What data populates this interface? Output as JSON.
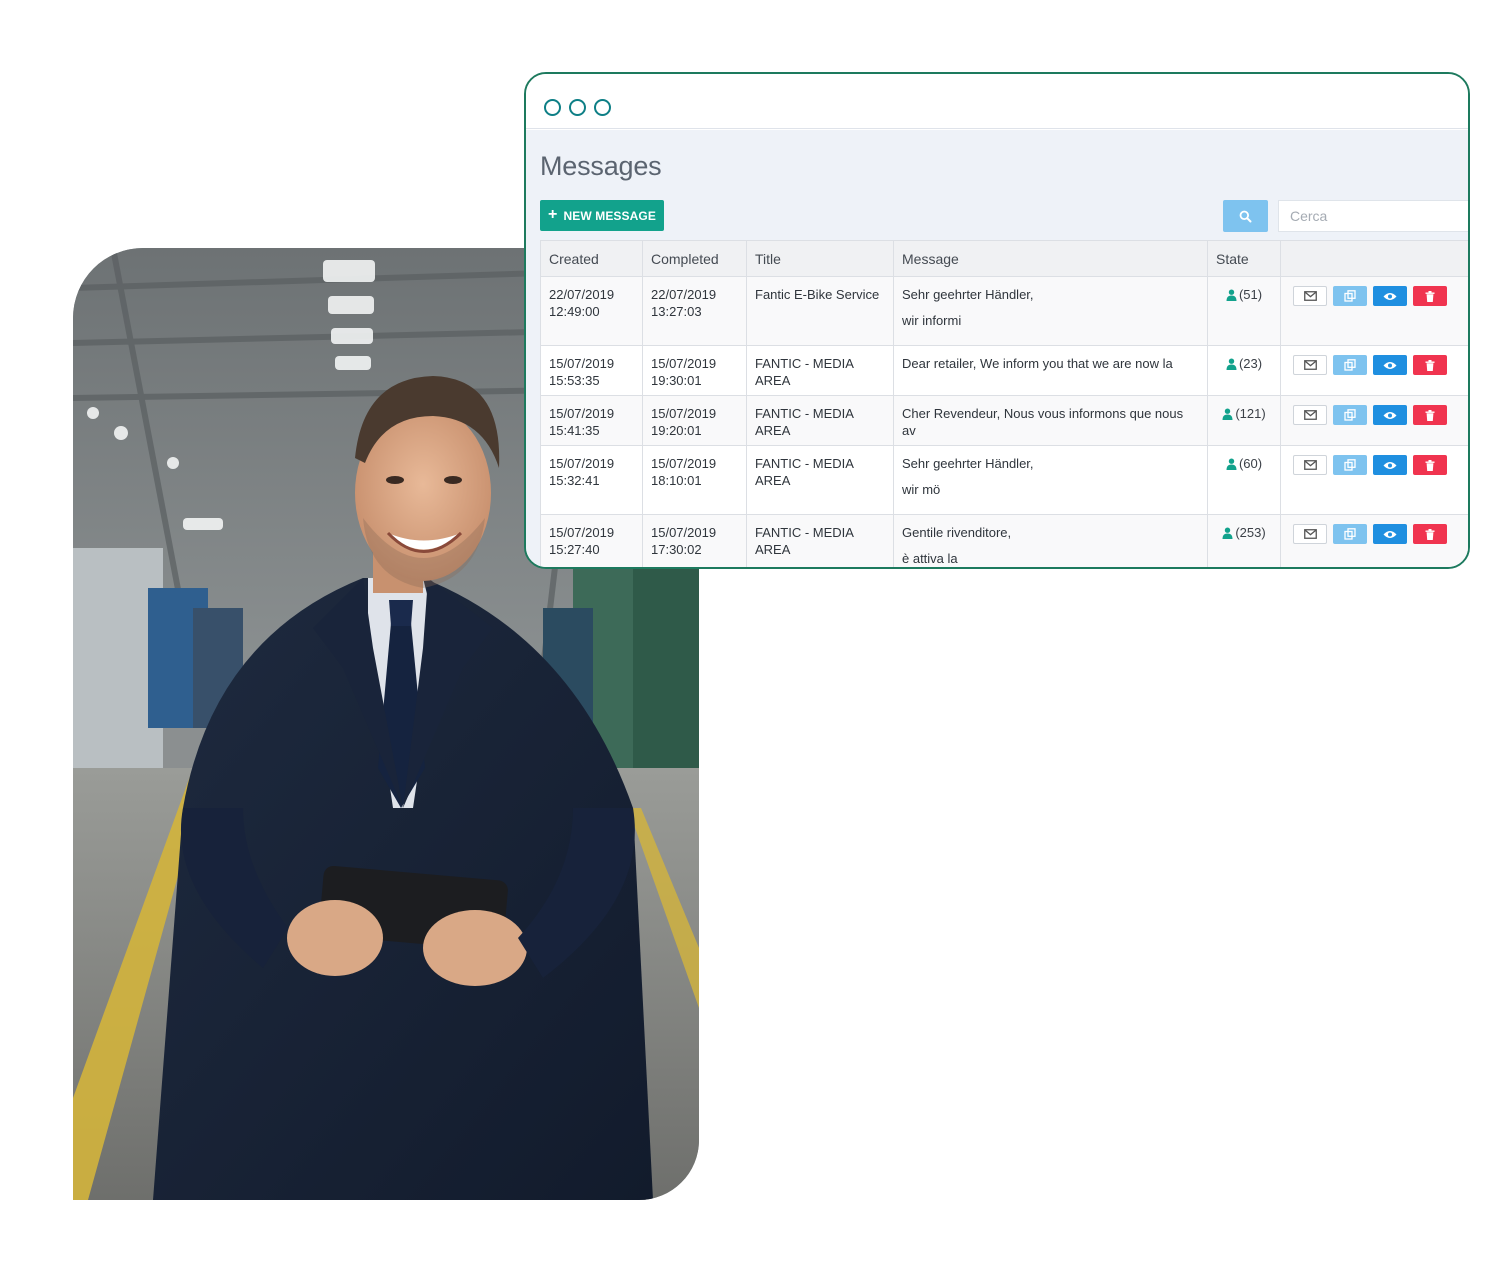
{
  "window": {
    "page_title": "Messages",
    "new_message_label": "NEW MESSAGE",
    "search_placeholder": "Cerca"
  },
  "table": {
    "columns": [
      "Created",
      "Completed",
      "Title",
      "Message",
      "State",
      ""
    ],
    "rows": [
      {
        "created_date": "22/07/2019",
        "created_time": "12:49:00",
        "completed_date": "22/07/2019",
        "completed_time": "13:27:03",
        "title": "Fantic E-Bike Service",
        "message_line1": "Sehr geehrter Händler,",
        "message_line2": "wir informi",
        "state": "(51)"
      },
      {
        "created_date": "15/07/2019",
        "created_time": "15:53:35",
        "completed_date": "15/07/2019",
        "completed_time": "19:30:01",
        "title": "FANTIC - MEDIA AREA",
        "message_line1": "Dear retailer, We inform you that we are now la",
        "message_line2": "",
        "state": "(23)"
      },
      {
        "created_date": "15/07/2019",
        "created_time": "15:41:35",
        "completed_date": "15/07/2019",
        "completed_time": "19:20:01",
        "title": "FANTIC - MEDIA AREA",
        "message_line1": "Cher Revendeur, Nous vous informons que nous av",
        "message_line2": "",
        "state": "(121)"
      },
      {
        "created_date": "15/07/2019",
        "created_time": "15:32:41",
        "completed_date": "15/07/2019",
        "completed_time": "18:10:01",
        "title": "FANTIC - MEDIA AREA",
        "message_line1": "Sehr geehrter Händler,",
        "message_line2": "wir mö",
        "state": "(60)"
      },
      {
        "created_date": "15/07/2019",
        "created_time": "15:27:40",
        "completed_date": "15/07/2019",
        "completed_time": "17:30:02",
        "title": "FANTIC - MEDIA AREA",
        "message_line1": "Gentile rivenditore,",
        "message_line2": "è attiva la",
        "state": "(253)"
      }
    ]
  },
  "icons": {
    "window_dots": "window-control-circles",
    "new_message": "plus-icon",
    "search": "search-icon",
    "state": "user-icon",
    "actions": [
      "envelope-icon",
      "copy-icon",
      "eye-icon",
      "trash-icon"
    ]
  },
  "colors": {
    "window_border": "#1d7a5e",
    "window_dots": "#0e7f86",
    "primary_button": "#12a28c",
    "search_button": "#7ec3ef",
    "copy_button": "#7ec3ef",
    "view_button": "#1f8fe0",
    "delete_button": "#f0344f",
    "state_icon": "#12a28c",
    "content_background": "#eef2f8"
  }
}
